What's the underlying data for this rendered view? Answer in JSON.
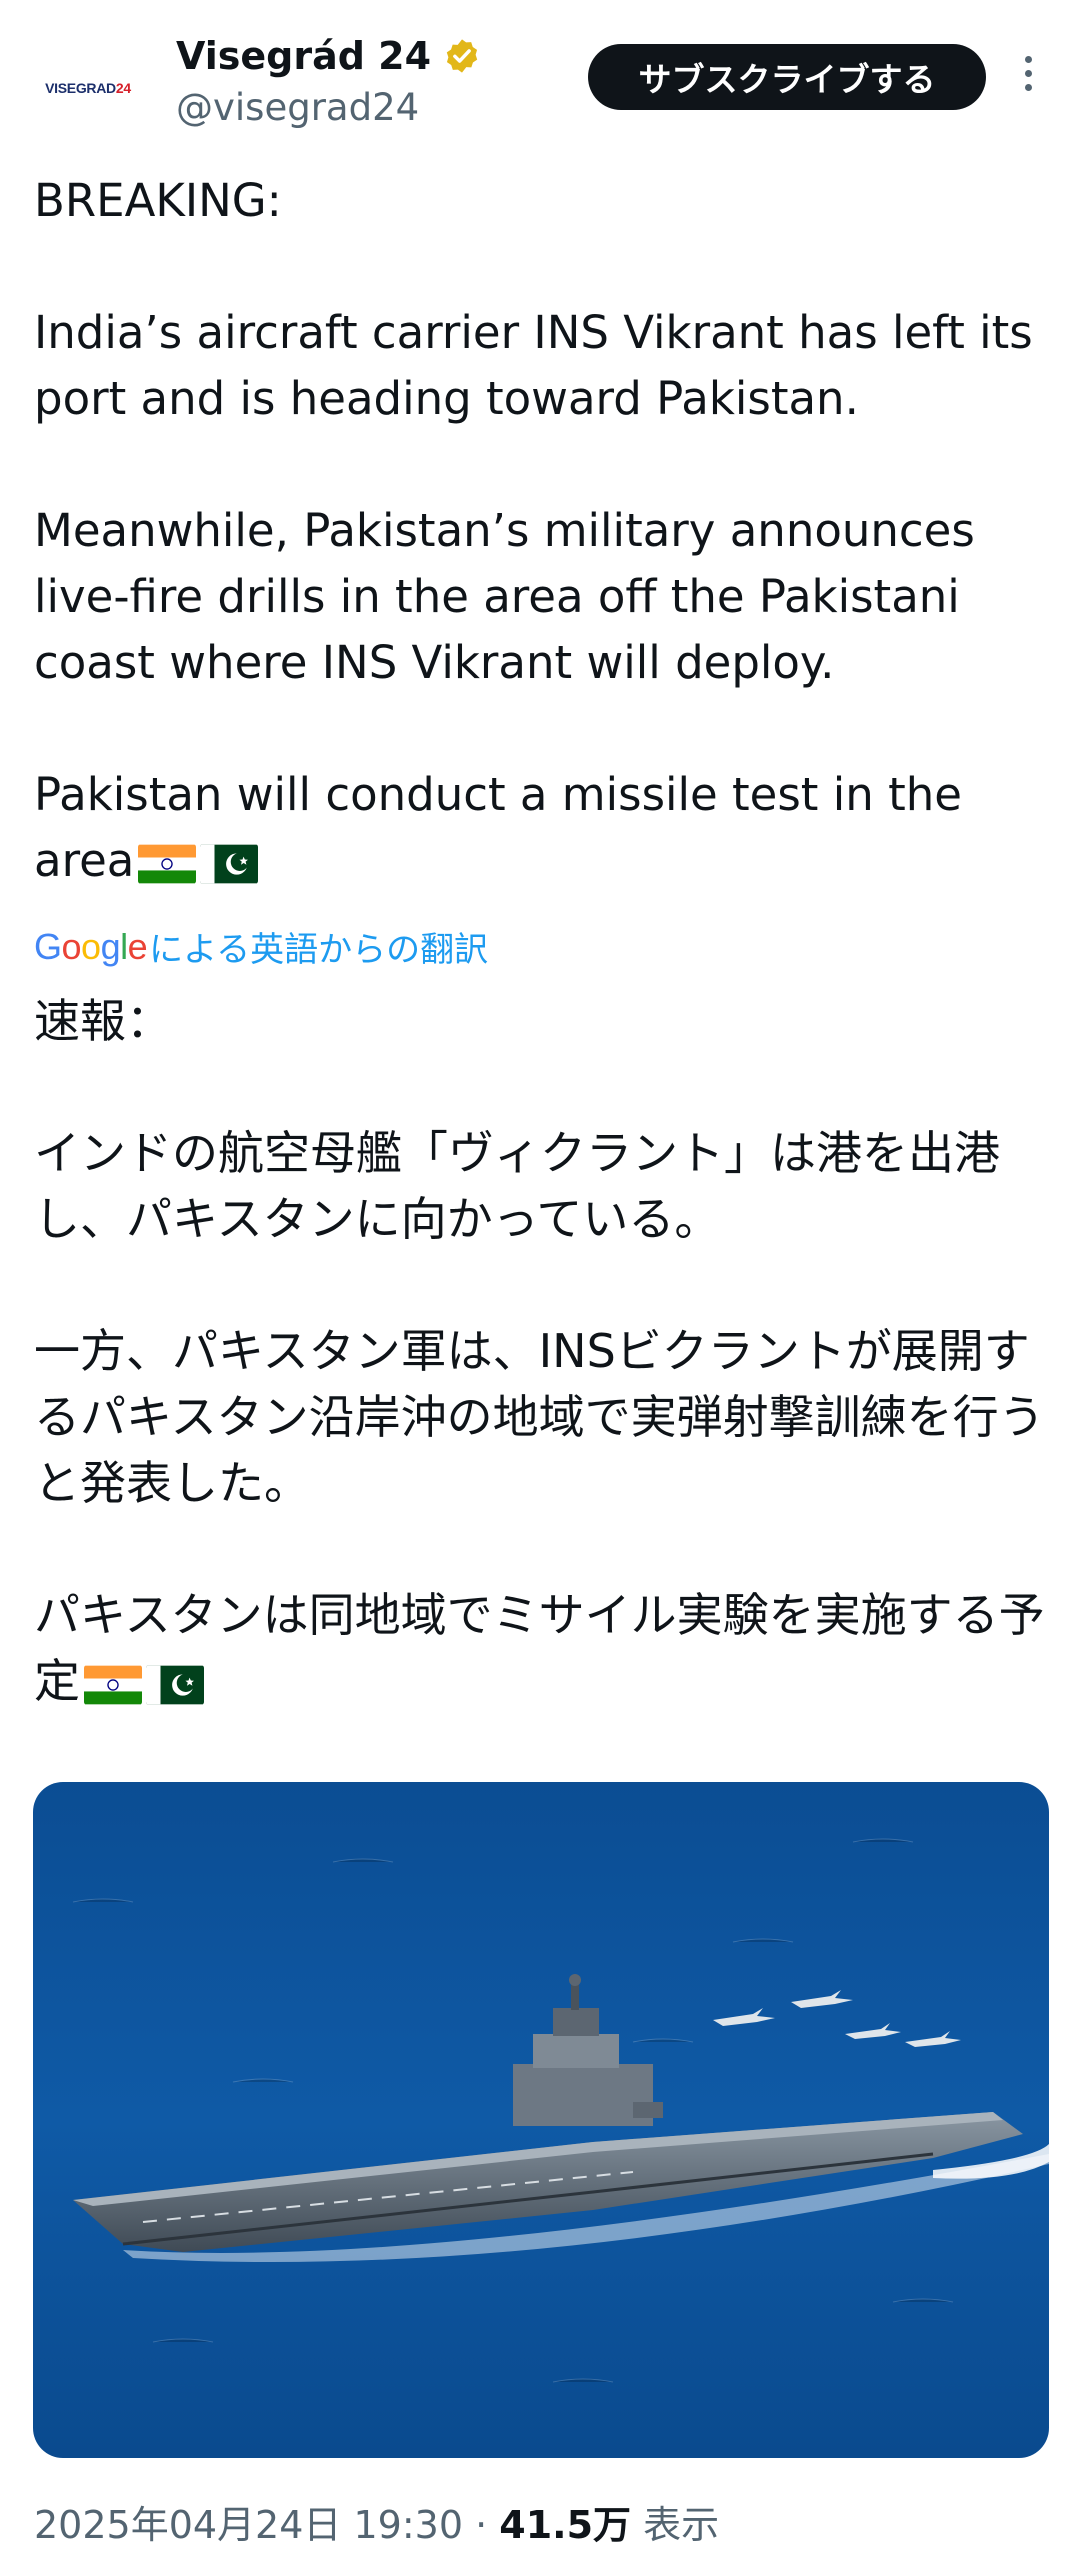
{
  "header": {
    "avatar_logo_left": "VISEGRAD",
    "avatar_logo_right": "24",
    "display_name": "Visegrád 24",
    "handle": "@visegrad24",
    "subscribe_label": "サブスクライブする",
    "verified_icon": "verified-badge-icon",
    "more_icon": "more-vertical-icon"
  },
  "tweet": {
    "paragraphs": [
      "BREAKING:",
      "India’s aircraft carrier INS Vikrant has left its port and is heading toward Pakistan.",
      "Meanwhile, Pakistan’s military announces live-fire drills in the area off the Pakistani coast where INS Vikrant will deploy.",
      "Pakistan will conduct a missile test in the area"
    ],
    "flags": [
      "india-flag-icon",
      "pakistan-flag-icon"
    ]
  },
  "translation": {
    "provider": "Google",
    "label": "による英語からの翻訳"
  },
  "translated": {
    "paragraphs": [
      "速報：",
      "インドの航空母艦「ヴィクラント」は港を出港し、パキスタンに向かっている。",
      "一方、パキスタン軍は、INSビクラントが展開するパキスタン沿岸沖の地域で実弾射撃訓練を行うと発表した。",
      "パキスタンは同地域でミサイル実験を実施する予定"
    ]
  },
  "media": {
    "subject": "aircraft-carrier-with-fighter-jets-photo"
  },
  "footer": {
    "timestamp": "2025年04月24日 19:30",
    "separator": " · ",
    "views_count": "41.5万",
    "views_label": " 表示"
  },
  "colors": {
    "link": "#1d9bf0",
    "secondary_text": "#536471",
    "verified_gold": "#e2b719",
    "button_bg": "#0f1419"
  }
}
